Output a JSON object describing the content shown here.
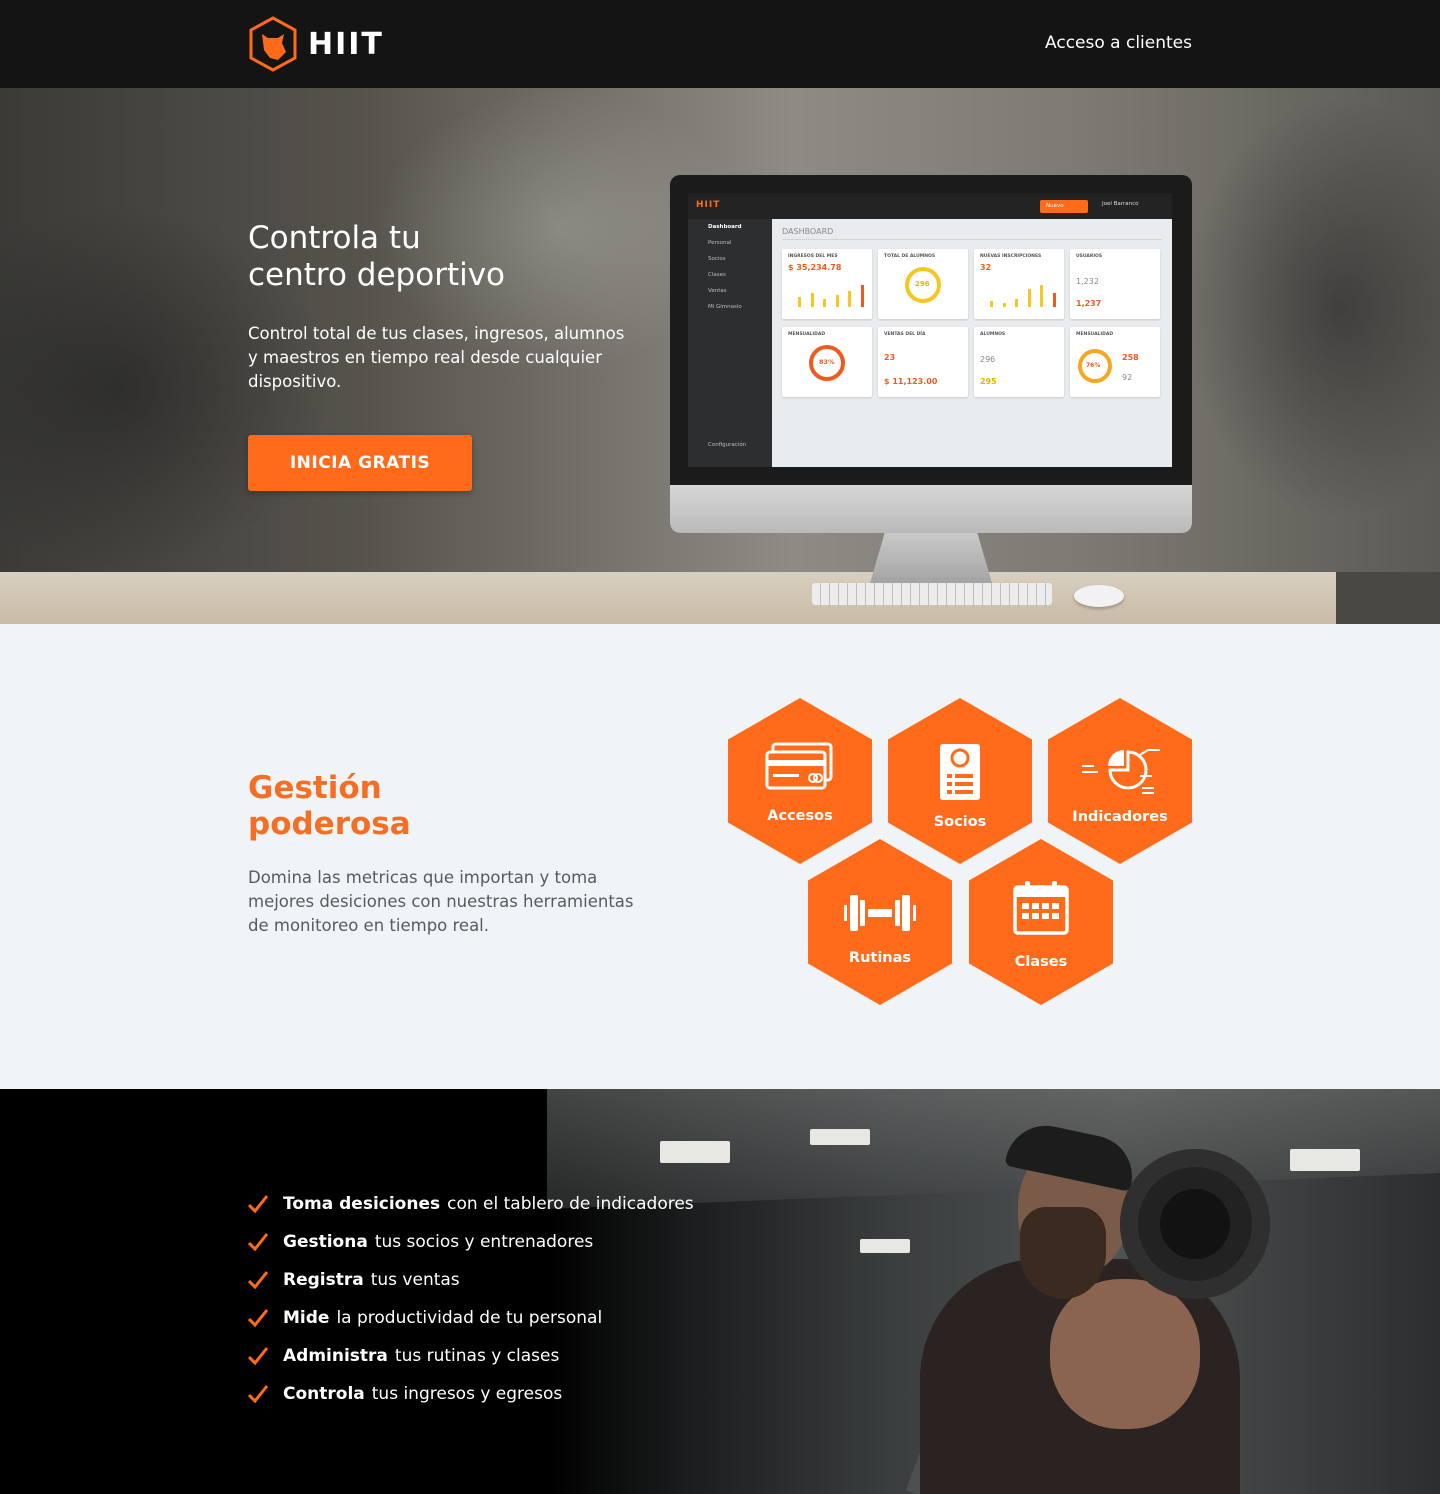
{
  "header": {
    "brand": "HIIT",
    "client_access": "Acceso a clientes"
  },
  "hero": {
    "title_line1": "Controla tu",
    "title_line2": "centro deportivo",
    "subtitle": "Control total de tus clases, ingresos, alumnos y maestros en tiempo real desde cualquier dispositivo.",
    "cta": "INICIA GRATIS"
  },
  "dashboard_preview": {
    "logo": "HIIT",
    "new_button": "Nuevo",
    "user": "Joel Barranco",
    "menu": [
      "Dashboard",
      "Personal",
      "Socios",
      "Clases",
      "Ventas",
      "Mi Gimnasio"
    ],
    "settings": "Configuración",
    "heading": "DASHBOARD",
    "cards": {
      "ingresos_title": "INGRESOS DEL MES",
      "ingresos_value": "$ 35,234.78",
      "alumnos_title": "TOTAL DE ALUMNOS",
      "alumnos_value": "296",
      "inscripciones_title": "NUEVAS INSCRIPCIONES",
      "inscripciones_value": "32",
      "usuarios_title": "USUARIOS",
      "usuarios_ayer": "1,232",
      "usuarios_hoy": "1,237",
      "mensualidad_title": "MENSUALIDAD",
      "mensualidad_pct": "83%",
      "ventas_title": "VENTAS DEL DÍA",
      "ventas_productos": "23",
      "ventas_ingresos": "$ 11,123.00",
      "alumnos2_title": "ALUMNOS",
      "alumnos2_ayer": "296",
      "alumnos2_hoy": "295",
      "mensualidad2_title": "MENSUALIDAD",
      "mensualidad2_pct": "76%",
      "mensualidad2_pagadas": "258",
      "mensualidad2_vencidas": "92"
    }
  },
  "gestion": {
    "title_line1": "Gestión",
    "title_line2": "poderosa",
    "text": "Domina las metricas que importan y toma mejores desiciones con nuestras herramientas de monitoreo en tiempo real.",
    "tiles": [
      "Accesos",
      "Socios",
      "Indicadores",
      "Rutinas",
      "Clases"
    ],
    "accent": "#ff6b1a"
  },
  "features": {
    "items": [
      {
        "bold": "Toma desiciones",
        "rest": "con el tablero de indicadores"
      },
      {
        "bold": "Gestiona",
        "rest": "tus socios y entrenadores"
      },
      {
        "bold": "Registra",
        "rest": "tus ventas"
      },
      {
        "bold": "Mide",
        "rest": "la productividad de tu personal"
      },
      {
        "bold": "Administra",
        "rest": "tus rutinas y clases"
      },
      {
        "bold": "Controla",
        "rest": "tus ingresos y egresos"
      }
    ]
  }
}
